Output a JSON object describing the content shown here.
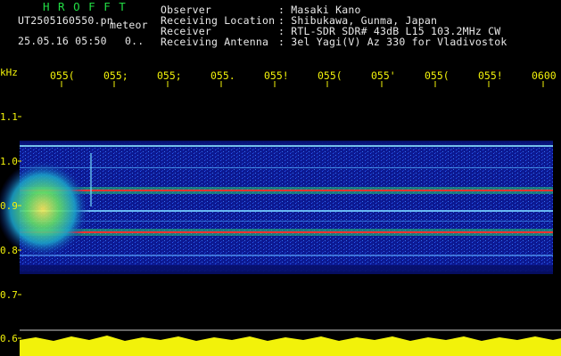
{
  "header": {
    "brand": "H R O F F T",
    "file": "UT2505160550.pn",
    "mode": "meteor",
    "datetime": "25.05.16 05:50",
    "extra": "0..",
    "info": [
      {
        "label": "Observer",
        "value": ": Masaki Kano"
      },
      {
        "label": "Receiving Location",
        "value": ": Shibukawa, Gunma, Japan"
      },
      {
        "label": "Receiver",
        "value": ": RTL-SDR SDR# 43dB L15 103.2MHz CW"
      },
      {
        "label": "Receiving Antenna",
        "value": ": 3el Yagi(V) Az 330 for Vladivostok"
      }
    ]
  },
  "axes": {
    "y_unit": "kHz",
    "y_ticks": [
      "1.1",
      "1.0",
      "0.9",
      "0.8",
      "0.7",
      "0.6"
    ],
    "x_ticks": [
      "055(",
      "055;",
      "055;",
      "055.",
      "055!",
      "055(",
      "055'",
      "055(",
      "055!",
      "0600"
    ]
  },
  "colors": {
    "background": "#000000",
    "axis": "#f2f20a",
    "brand": "#22dd44",
    "text": "#e8e8e8"
  }
}
